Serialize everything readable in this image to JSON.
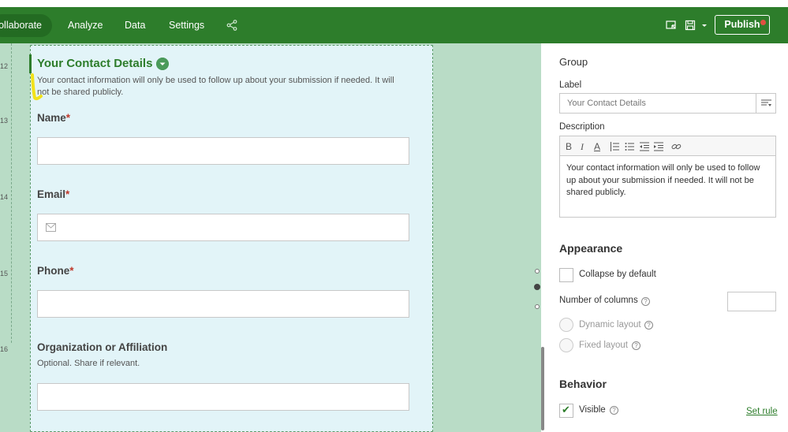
{
  "topbar": {
    "nav": [
      "Collaborate",
      "Analyze",
      "Data",
      "Settings"
    ],
    "publish_label": "Publish",
    "colors": {
      "bar": "#2d7d2b",
      "publish_dot": "#e15040"
    },
    "icons": [
      "share-icon",
      "preview-icon",
      "save-icon",
      "dropdown-caret-icon"
    ]
  },
  "canvas": {
    "row_numbers": [
      "12",
      "13",
      "14",
      "15",
      "16"
    ],
    "group": {
      "title": "Your Contact Details",
      "description": "Your contact information will only be used to follow up about your submission if needed. It will not be shared publicly."
    },
    "fields": [
      {
        "label": "Name",
        "required_mark": "*"
      },
      {
        "label": "Email",
        "required_mark": "*"
      },
      {
        "label": "Phone",
        "required_mark": "*"
      },
      {
        "label": "Organization or Affiliation",
        "hint": "Optional. Share if relevant."
      }
    ]
  },
  "panel": {
    "section_title": "Group",
    "label_heading": "Label",
    "label_value": "Your Contact Details",
    "description_heading": "Description",
    "toolbar": [
      "B",
      "I",
      "A"
    ],
    "description_value": "Your contact information will only be used to follow up about your submission if needed. It will not be shared publicly.",
    "appearance": {
      "title": "Appearance",
      "collapse_label": "Collapse by default",
      "columns_label": "Number of columns",
      "dynamic_label": "Dynamic layout",
      "fixed_label": "Fixed layout"
    },
    "behavior": {
      "title": "Behavior",
      "visible_label": "Visible",
      "visible_checked": true,
      "set_rule_label": "Set rule"
    }
  }
}
